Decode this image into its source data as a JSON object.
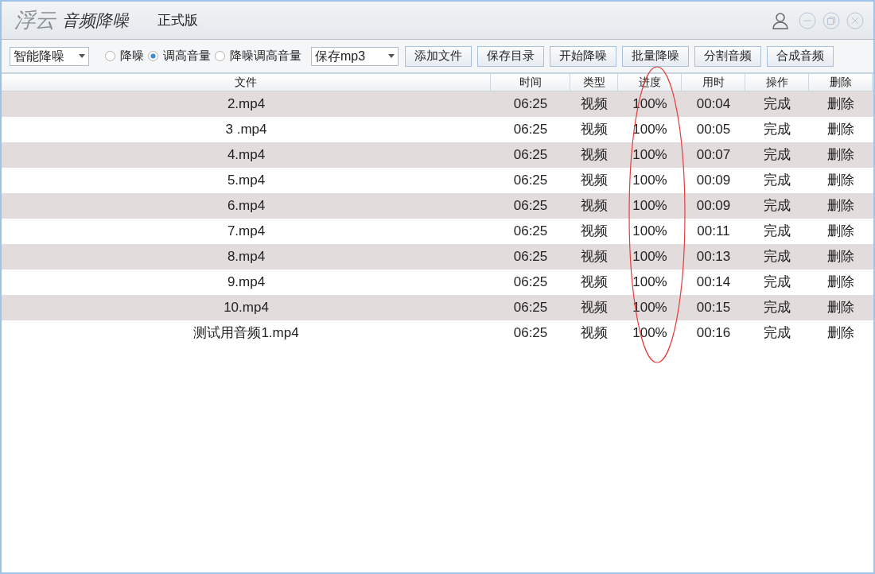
{
  "window": {
    "logo": "浮云",
    "title": "音频降噪",
    "edition": "正式版"
  },
  "toolbar": {
    "mode_select": "智能降噪",
    "radios": [
      {
        "label": "降噪",
        "selected": false
      },
      {
        "label": "调高音量",
        "selected": true
      },
      {
        "label": "降噪调高音量",
        "selected": false
      }
    ],
    "format_select": "保存mp3",
    "buttons": [
      "添加文件",
      "保存目录",
      "开始降噪",
      "批量降噪",
      "分割音频",
      "合成音频"
    ]
  },
  "table": {
    "columns": [
      "文件",
      "时间",
      "类型",
      "进度",
      "用时",
      "操作",
      "删除"
    ],
    "rows": [
      [
        "2.mp4",
        "06:25",
        "视频",
        "100%",
        "00:04",
        "完成",
        "删除"
      ],
      [
        "3 .mp4",
        "06:25",
        "视频",
        "100%",
        "00:05",
        "完成",
        "删除"
      ],
      [
        "4.mp4",
        "06:25",
        "视频",
        "100%",
        "00:07",
        "完成",
        "删除"
      ],
      [
        "5.mp4",
        "06:25",
        "视频",
        "100%",
        "00:09",
        "完成",
        "删除"
      ],
      [
        "6.mp4",
        "06:25",
        "视频",
        "100%",
        "00:09",
        "完成",
        "删除"
      ],
      [
        "7.mp4",
        "06:25",
        "视频",
        "100%",
        "00:11",
        "完成",
        "删除"
      ],
      [
        "8.mp4",
        "06:25",
        "视频",
        "100%",
        "00:13",
        "完成",
        "删除"
      ],
      [
        "9.mp4",
        "06:25",
        "视频",
        "100%",
        "00:14",
        "完成",
        "删除"
      ],
      [
        "10.mp4",
        "06:25",
        "视频",
        "100%",
        "00:15",
        "完成",
        "删除"
      ],
      [
        "测试用音频1.mp4",
        "06:25",
        "视频",
        "100%",
        "00:16",
        "完成",
        "删除"
      ]
    ]
  }
}
